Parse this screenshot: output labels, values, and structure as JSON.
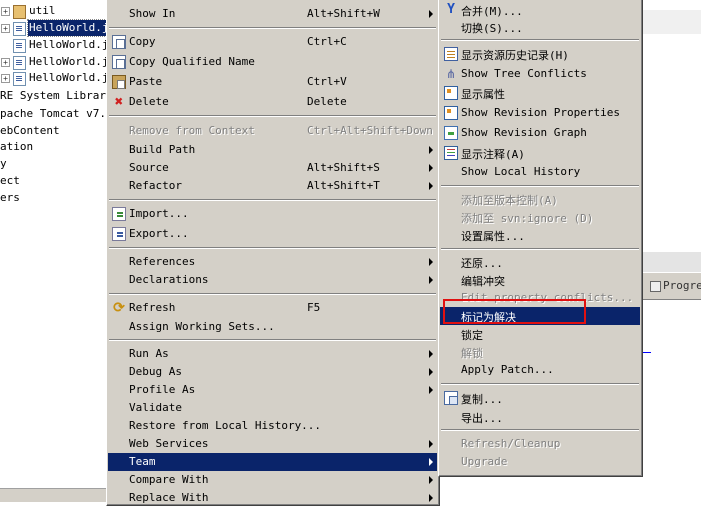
{
  "tree": {
    "items": [
      {
        "label": "util",
        "icon": "package-icon"
      },
      {
        "label": "HelloWorld.ja",
        "icon": "java-file-icon",
        "selected": true
      },
      {
        "label": "HelloWorld.ja",
        "icon": "java-file-icon"
      },
      {
        "label": "HelloWorld.ja",
        "icon": "java-file-icon"
      },
      {
        "label": "HelloWorld.ja",
        "icon": "java-file-icon"
      },
      {
        "label": "RE System Library"
      },
      {
        "label": "pache Tomcat v7.0"
      },
      {
        "label": "ebContent"
      },
      {
        "label": "ation"
      },
      {
        "label": "y"
      },
      {
        "label": "ect"
      },
      {
        "label": "ers"
      }
    ]
  },
  "context_menu": {
    "show_in": {
      "label": "Show In",
      "shortcut": "Alt+Shift+W"
    },
    "copy": {
      "label": "Copy",
      "shortcut": "Ctrl+C"
    },
    "copy_qualified": {
      "label": "Copy Qualified Name"
    },
    "paste": {
      "label": "Paste",
      "shortcut": "Ctrl+V"
    },
    "delete": {
      "label": "Delete",
      "shortcut": "Delete"
    },
    "remove_context": {
      "label": "Remove from Context",
      "shortcut": "Ctrl+Alt+Shift+Down"
    },
    "build_path": {
      "label": "Build Path"
    },
    "source": {
      "label": "Source",
      "shortcut": "Alt+Shift+S"
    },
    "refactor": {
      "label": "Refactor",
      "shortcut": "Alt+Shift+T"
    },
    "import": {
      "label": "Import..."
    },
    "export": {
      "label": "Export..."
    },
    "references": {
      "label": "References"
    },
    "declarations": {
      "label": "Declarations"
    },
    "refresh": {
      "label": "Refresh",
      "shortcut": "F5"
    },
    "assign_working_sets": {
      "label": "Assign Working Sets..."
    },
    "run_as": {
      "label": "Run As"
    },
    "debug_as": {
      "label": "Debug As"
    },
    "profile_as": {
      "label": "Profile As"
    },
    "validate": {
      "label": "Validate"
    },
    "restore_history": {
      "label": "Restore from Local History..."
    },
    "web_services": {
      "label": "Web Services"
    },
    "team": {
      "label": "Team"
    },
    "compare_with": {
      "label": "Compare With"
    },
    "replace_with": {
      "label": "Replace With"
    }
  },
  "team_menu": {
    "merge": {
      "label": "合并(M)..."
    },
    "switch": {
      "label": "切换(S)..."
    },
    "show_history": {
      "label": "显示资源历史记录(H)"
    },
    "show_tree_conflicts": {
      "label": "Show Tree Conflicts"
    },
    "show_properties": {
      "label": "显示属性"
    },
    "show_revision_properties": {
      "label": "Show Revision Properties"
    },
    "show_revision_graph": {
      "label": "Show Revision Graph"
    },
    "show_annotation": {
      "label": "显示注释(A)"
    },
    "show_local_history": {
      "label": "Show Local History"
    },
    "add_to_vc": {
      "label": "添加至版本控制(A)"
    },
    "add_to_ignore": {
      "label": "添加至 svn:ignore (D)"
    },
    "set_property": {
      "label": "设置属性..."
    },
    "revert": {
      "label": "还原..."
    },
    "edit_conflicts": {
      "label": "编辑冲突"
    },
    "edit_property_conflicts": {
      "label": "Edit property conflicts..."
    },
    "mark_resolved": {
      "label": "标记为解决"
    },
    "lock": {
      "label": "锁定"
    },
    "unlock": {
      "label": "解锁"
    },
    "apply_patch": {
      "label": "Apply Patch..."
    },
    "copy": {
      "label": "复制..."
    },
    "export": {
      "label": "导出..."
    },
    "refresh_cleanup": {
      "label": "Refresh/Cleanup"
    },
    "upgrade": {
      "label": "Upgrade"
    }
  },
  "background": {
    "progress_tab": "Progres"
  },
  "colors": {
    "menu_bg": "#d4d0c8",
    "highlight": "#0a246a",
    "annotation_box": "#e01010"
  }
}
